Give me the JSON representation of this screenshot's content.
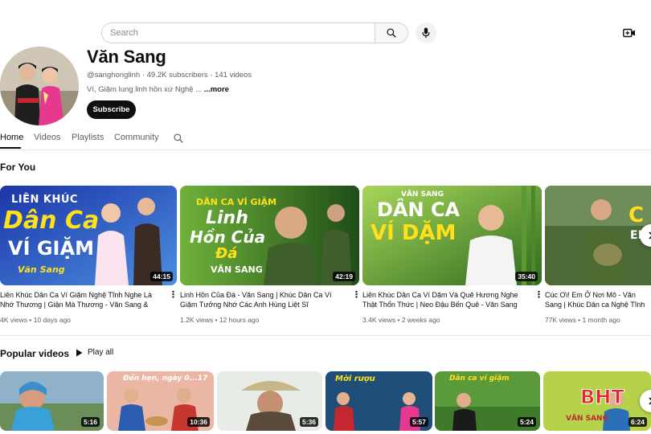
{
  "search": {
    "placeholder": "Search"
  },
  "channel": {
    "name": "Văn Sang",
    "handle": "@sanghonglinh",
    "subscribers": "49.2K subscribers",
    "videos_count": "141 videos",
    "description": "Ví, Giặm lung linh hồn xứ Nghệ ...",
    "more_label": "...more",
    "subscribe_label": "Subscribe"
  },
  "tabs": [
    {
      "label": "Home"
    },
    {
      "label": "Videos"
    },
    {
      "label": "Playlists"
    },
    {
      "label": "Community"
    }
  ],
  "for_you": {
    "title": "For You",
    "videos": [
      {
        "title": "Liên Khúc Dân Ca Ví Giặm Nghệ Tĩnh Nghe Là Nhớ Thương | Giận Mà Thương - Văn Sang & Thanh Quý",
        "views": "4K views",
        "age": "10 days ago",
        "duration": "44:15",
        "thumb_text": {
          "line1": "LIÊN KHÚC",
          "line2": "Dân Ca",
          "line3": "VÍ GIẶM",
          "line4": "Văn Sang"
        }
      },
      {
        "title": "Linh Hồn Của Đá - Văn Sang | Khúc Dân Ca Ví Giặm Tưởng Nhớ Các Anh Hùng Liệt Sĩ",
        "views": "1.2K views",
        "age": "12 hours ago",
        "duration": "42:19",
        "thumb_text": {
          "line1": "DÂN CA VÍ GIẶM",
          "line2": "Linh",
          "line3": "Hồn Của",
          "line4": "Đá",
          "line5": "VĂN SANG"
        }
      },
      {
        "title": "Liên Khúc Dân Ca Ví Dặm Và Quê Hương Nghe Thật Thổn Thức | Neo Đậu Bến Quê - Văn Sang",
        "views": "3.4K views",
        "age": "2 weeks ago",
        "duration": "35:40",
        "thumb_text": {
          "line1": "VĂN SANG",
          "line2": "DÂN CA",
          "line3": "VÍ DẶM"
        }
      },
      {
        "title": "Cúc Ơi! Em Ở Nơi Mô - Văn Sang | Khúc Dân ca Nghệ Tĩnh Nghe Mà Rơi Nước Mắt",
        "views": "77K views",
        "age": "1 month ago",
        "duration": "",
        "thumb_text": {
          "line1": "C",
          "line2": "EM"
        }
      }
    ]
  },
  "popular": {
    "title": "Popular videos",
    "play_all_label": "Play all",
    "videos": [
      {
        "duration": "5:16"
      },
      {
        "duration": "10:36",
        "thumb_text": "Đến hẹn, ngày 0...17"
      },
      {
        "duration": "5:36"
      },
      {
        "duration": "5:57",
        "thumb_text": "Mời rượu"
      },
      {
        "duration": "5:24",
        "thumb_text": "Dân ca ví giặm"
      },
      {
        "duration": "6:24",
        "thumb_text": "VĂN SANG",
        "watermark": "BHT"
      }
    ]
  }
}
